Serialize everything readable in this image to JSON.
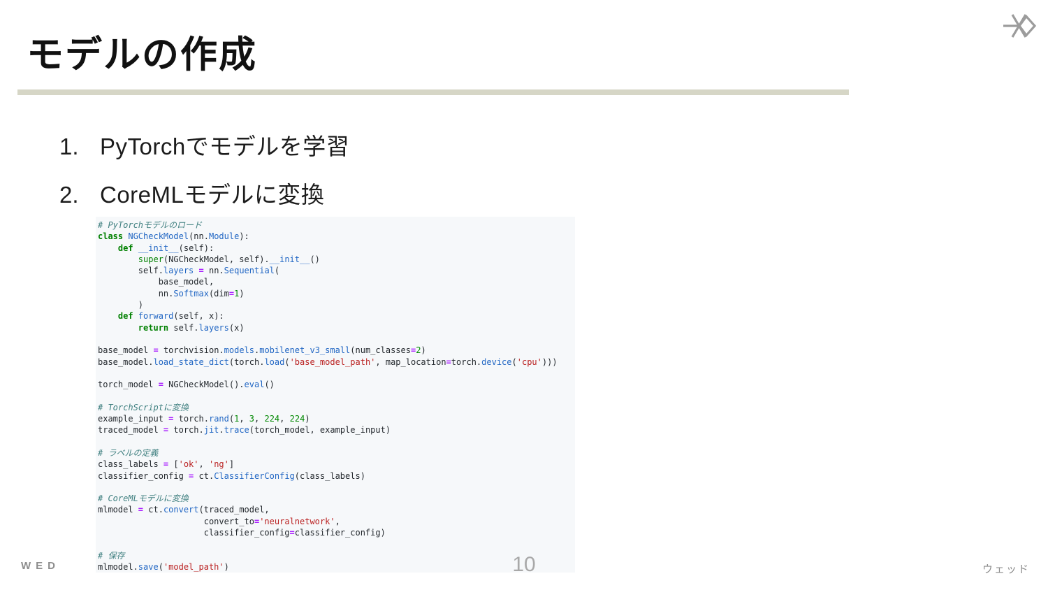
{
  "slide": {
    "title": "モデルの作成"
  },
  "steps": [
    {
      "num": "1.",
      "text": "PyTorchでモデルを学習"
    },
    {
      "num": "2.",
      "text": "CoreMLモデルに変換"
    }
  ],
  "code": {
    "language": "python",
    "lines": [
      [
        [
          "c",
          "# PyTorchモデルのロード"
        ]
      ],
      [
        [
          "k",
          "class"
        ],
        [
          "p",
          " "
        ],
        [
          "f",
          "NGCheckModel"
        ],
        [
          "p",
          "(nn."
        ],
        [
          "f",
          "Module"
        ],
        [
          "p",
          "):"
        ]
      ],
      [
        [
          "p",
          "    "
        ],
        [
          "k",
          "def"
        ],
        [
          "p",
          " "
        ],
        [
          "f",
          "__init__"
        ],
        [
          "p",
          "(self):"
        ]
      ],
      [
        [
          "p",
          "        "
        ],
        [
          "b",
          "super"
        ],
        [
          "p",
          "(NGCheckModel, self)."
        ],
        [
          "f",
          "__init__"
        ],
        [
          "p",
          "()"
        ]
      ],
      [
        [
          "p",
          "        self."
        ],
        [
          "f",
          "layers"
        ],
        [
          "p",
          " "
        ],
        [
          "o",
          "="
        ],
        [
          "p",
          " nn."
        ],
        [
          "f",
          "Sequential"
        ],
        [
          "p",
          "("
        ]
      ],
      [
        [
          "p",
          "            base_model,"
        ]
      ],
      [
        [
          "p",
          "            nn."
        ],
        [
          "f",
          "Softmax"
        ],
        [
          "p",
          "(dim"
        ],
        [
          "o",
          "="
        ],
        [
          "m",
          "1"
        ],
        [
          "p",
          ")"
        ]
      ],
      [
        [
          "p",
          "        )"
        ]
      ],
      [
        [
          "p",
          "    "
        ],
        [
          "k",
          "def"
        ],
        [
          "p",
          " "
        ],
        [
          "f",
          "forward"
        ],
        [
          "p",
          "(self, x):"
        ]
      ],
      [
        [
          "p",
          "        "
        ],
        [
          "k",
          "return"
        ],
        [
          "p",
          " self."
        ],
        [
          "f",
          "layers"
        ],
        [
          "p",
          "(x)"
        ]
      ],
      [],
      [
        [
          "p",
          "base_model "
        ],
        [
          "o",
          "="
        ],
        [
          "p",
          " torchvision."
        ],
        [
          "f",
          "models"
        ],
        [
          "p",
          "."
        ],
        [
          "f",
          "mobilenet_v3_small"
        ],
        [
          "p",
          "(num_classes"
        ],
        [
          "o",
          "="
        ],
        [
          "m",
          "2"
        ],
        [
          "p",
          ")"
        ]
      ],
      [
        [
          "p",
          "base_model."
        ],
        [
          "f",
          "load_state_dict"
        ],
        [
          "p",
          "(torch."
        ],
        [
          "f",
          "load"
        ],
        [
          "p",
          "("
        ],
        [
          "s",
          "'base_model_path'"
        ],
        [
          "p",
          ", map_location"
        ],
        [
          "o",
          "="
        ],
        [
          "p",
          "torch."
        ],
        [
          "f",
          "device"
        ],
        [
          "p",
          "("
        ],
        [
          "s",
          "'cpu'"
        ],
        [
          "p",
          ")))"
        ]
      ],
      [],
      [
        [
          "p",
          "torch_model "
        ],
        [
          "o",
          "="
        ],
        [
          "p",
          " NGCheckModel()."
        ],
        [
          "f",
          "eval"
        ],
        [
          "p",
          "()"
        ]
      ],
      [],
      [
        [
          "c",
          "# TorchScriptに変換"
        ]
      ],
      [
        [
          "p",
          "example_input "
        ],
        [
          "o",
          "="
        ],
        [
          "p",
          " torch."
        ],
        [
          "f",
          "rand"
        ],
        [
          "p",
          "("
        ],
        [
          "m",
          "1"
        ],
        [
          "p",
          ", "
        ],
        [
          "m",
          "3"
        ],
        [
          "p",
          ", "
        ],
        [
          "m",
          "224"
        ],
        [
          "p",
          ", "
        ],
        [
          "m",
          "224"
        ],
        [
          "p",
          ")"
        ]
      ],
      [
        [
          "p",
          "traced_model "
        ],
        [
          "o",
          "="
        ],
        [
          "p",
          " torch."
        ],
        [
          "f",
          "jit"
        ],
        [
          "p",
          "."
        ],
        [
          "f",
          "trace"
        ],
        [
          "p",
          "(torch_model, example_input)"
        ]
      ],
      [],
      [
        [
          "c",
          "# ラベルの定義"
        ]
      ],
      [
        [
          "p",
          "class_labels "
        ],
        [
          "o",
          "="
        ],
        [
          "p",
          " ["
        ],
        [
          "s",
          "'ok'"
        ],
        [
          "p",
          ", "
        ],
        [
          "s",
          "'ng'"
        ],
        [
          "p",
          "]"
        ]
      ],
      [
        [
          "p",
          "classifier_config "
        ],
        [
          "o",
          "="
        ],
        [
          "p",
          " ct."
        ],
        [
          "f",
          "ClassifierConfig"
        ],
        [
          "p",
          "(class_labels)"
        ]
      ],
      [],
      [
        [
          "c",
          "# CoreMLモデルに変換"
        ]
      ],
      [
        [
          "p",
          "mlmodel "
        ],
        [
          "o",
          "="
        ],
        [
          "p",
          " ct."
        ],
        [
          "f",
          "convert"
        ],
        [
          "p",
          "(traced_model,"
        ]
      ],
      [
        [
          "p",
          "                     convert_to"
        ],
        [
          "o",
          "="
        ],
        [
          "s",
          "'neuralnetwork'"
        ],
        [
          "p",
          ","
        ]
      ],
      [
        [
          "p",
          "                     classifier_config"
        ],
        [
          "o",
          "="
        ],
        [
          "p",
          "classifier_config)"
        ]
      ],
      [],
      [
        [
          "c",
          "# 保存"
        ]
      ],
      [
        [
          "p",
          "mlmodel."
        ],
        [
          "f",
          "save"
        ],
        [
          "p",
          "("
        ],
        [
          "s",
          "'model_path'"
        ],
        [
          "p",
          ")"
        ]
      ]
    ]
  },
  "footer": {
    "logo": "WED",
    "page_number": "10",
    "company": "ウェッド"
  },
  "icons": {
    "top_right": "wed-mark-icon"
  },
  "colors": {
    "title": "#111111",
    "body-text": "#1c1c1c",
    "accent-rule": "#d6d6c6",
    "code-bg": "#f6f8fa",
    "code-default": "#24292e",
    "keyword": "#008000",
    "builtin": "#008000",
    "name-blue": "#2267c4",
    "string": "#ba2121",
    "number": "#008800",
    "operator": "#aa22ff",
    "comment": "#408080",
    "footer-gray": "#8d8d8d",
    "page-number-gray": "#a8a8a8",
    "icon-gray": "#9c9c9c"
  }
}
